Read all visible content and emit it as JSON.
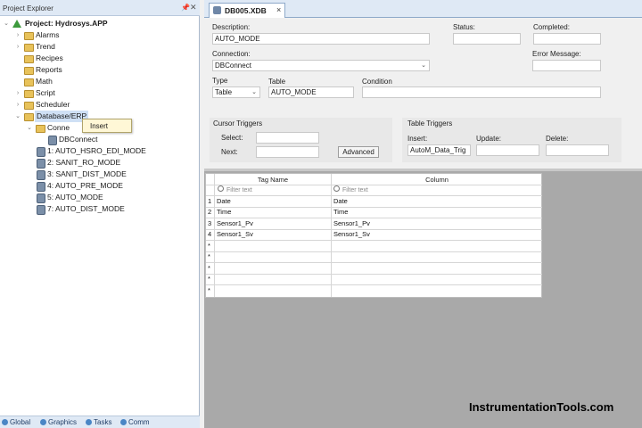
{
  "explorer": {
    "title": "Project Explorer",
    "pin_icon": "pin-icon",
    "close_icon": "close-icon",
    "project_label": "Project: Hydrosys.APP",
    "items": [
      {
        "label": "Alarms"
      },
      {
        "label": "Trend"
      },
      {
        "label": "Recipes"
      },
      {
        "label": "Reports"
      },
      {
        "label": "Math"
      },
      {
        "label": "Script"
      },
      {
        "label": "Scheduler"
      },
      {
        "label": "Database/ERP"
      }
    ],
    "conn_label": "Conne",
    "dbconnect_label": "DBConnect",
    "db_items": [
      {
        "label": "1: AUTO_HSRO_EDI_MODE"
      },
      {
        "label": "2: SANIT_RO_MODE"
      },
      {
        "label": "3: SANIT_DIST_MODE"
      },
      {
        "label": "4: AUTO_PRE_MODE"
      },
      {
        "label": "5: AUTO_MODE"
      },
      {
        "label": "7: AUTO_DIST_MODE"
      }
    ],
    "context_menu": {
      "insert": "Insert"
    },
    "bottom_tabs": [
      {
        "label": "Global"
      },
      {
        "label": "Graphics"
      },
      {
        "label": "Tasks"
      },
      {
        "label": "Comm"
      }
    ]
  },
  "document": {
    "tab_label": "DB005.XDB",
    "close_glyph": "×"
  },
  "form": {
    "description_label": "Description:",
    "description_value": "AUTO_MODE",
    "status_label": "Status:",
    "completed_label": "Completed:",
    "connection_label": "Connection:",
    "connection_value": "DBConnect",
    "error_label": "Error Message:",
    "type_label": "Type",
    "type_value": "Table",
    "table_label": "Table",
    "table_value": "AUTO_MODE",
    "condition_label": "Condition",
    "cursor_triggers_label": "Cursor Triggers",
    "select_label": "Select:",
    "next_label": "Next:",
    "advanced_label": "Advanced",
    "table_triggers_label": "Table Triggers",
    "insert_label": "Insert:",
    "insert_value": "AutoM_Data_Trig",
    "update_label": "Update:",
    "delete_label": "Delete:"
  },
  "grid": {
    "headers": [
      "Tag Name",
      "Column"
    ],
    "filter_placeholder": "Filter text",
    "rows": [
      {
        "num": "1",
        "tag": "Date",
        "column": "Date"
      },
      {
        "num": "2",
        "tag": "Time",
        "column": "Time"
      },
      {
        "num": "3",
        "tag": "Sensor1_Pv",
        "column": "Sensor1_Pv"
      },
      {
        "num": "4",
        "tag": "Sensor1_Sv",
        "column": "Sensor1_Sv"
      }
    ],
    "empty_marker": "*"
  },
  "watermark": "InstrumentationTools.com",
  "colors": {
    "panel_header": "#dfe9f5",
    "grid_background": "#a9a9a9",
    "folder": "#e8c25a",
    "context_menu": "#fff7d6"
  }
}
